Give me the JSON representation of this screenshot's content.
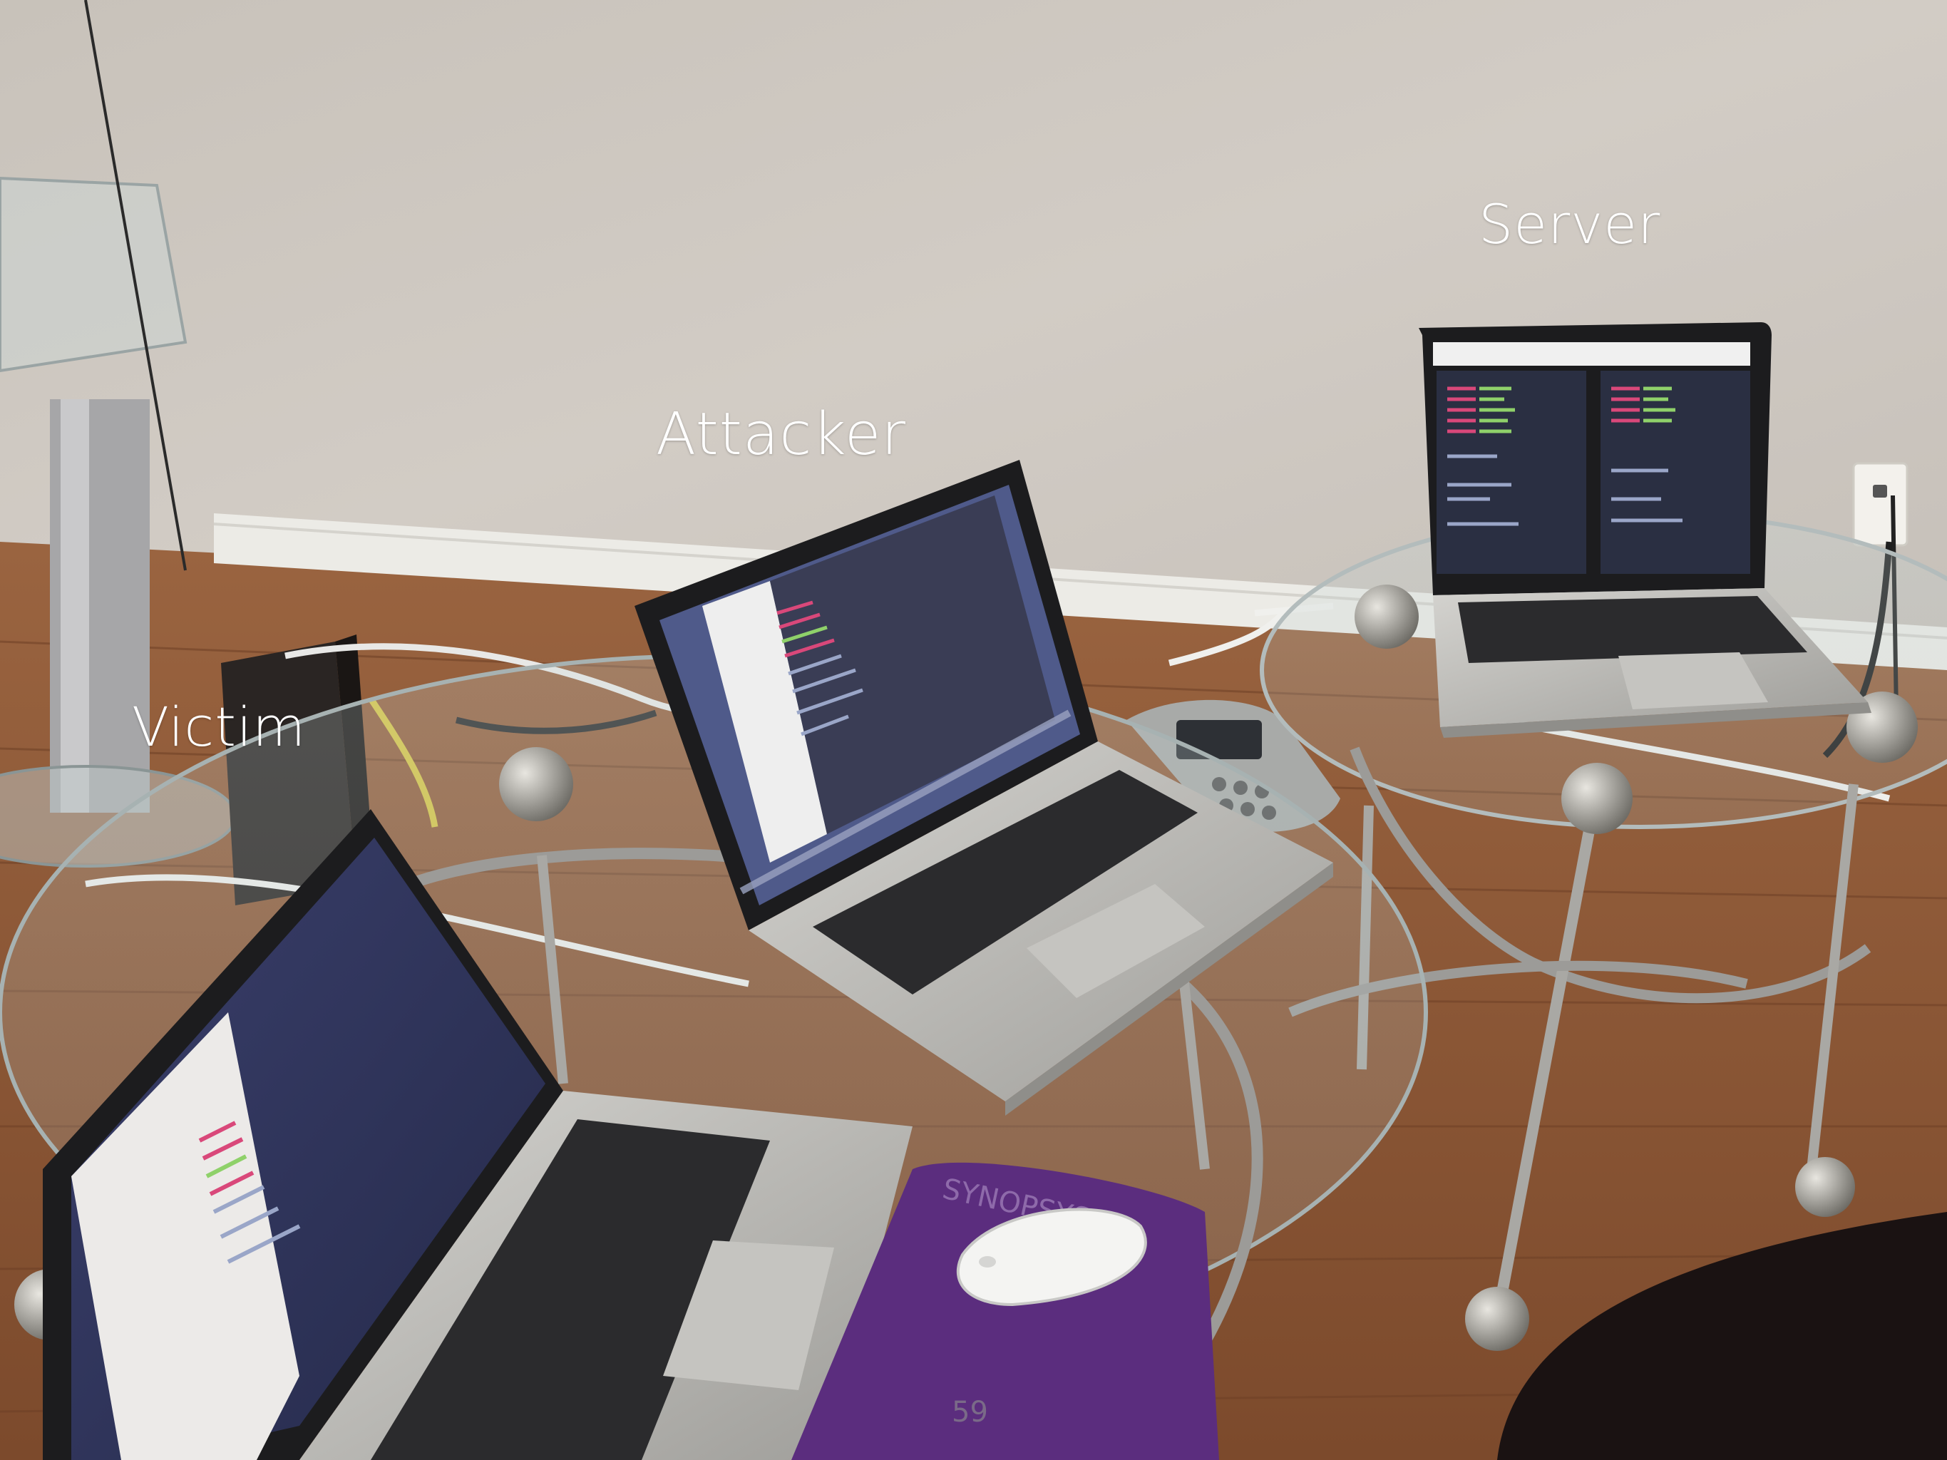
{
  "labels": {
    "server": "Server",
    "attacker": "Attacker",
    "victim": "Victim"
  },
  "slide_number": "59",
  "colors": {
    "wall": "#cfc9c2",
    "floor": "#8b5634",
    "baseboard": "#ece9e4",
    "laptop_silver": "#b9b8b4",
    "keyboard": "#2a2a2c",
    "screen_dark": "#25283a",
    "mousepad": "#5b2d7e",
    "label_text": "#ffffff"
  },
  "icons": [
    "laptop-server-icon",
    "laptop-attacker-icon",
    "laptop-victim-icon",
    "mouse-icon",
    "mousepad-icon",
    "glass-table-icon",
    "router-icon",
    "phone-icon",
    "wall-outlet-icon"
  ]
}
